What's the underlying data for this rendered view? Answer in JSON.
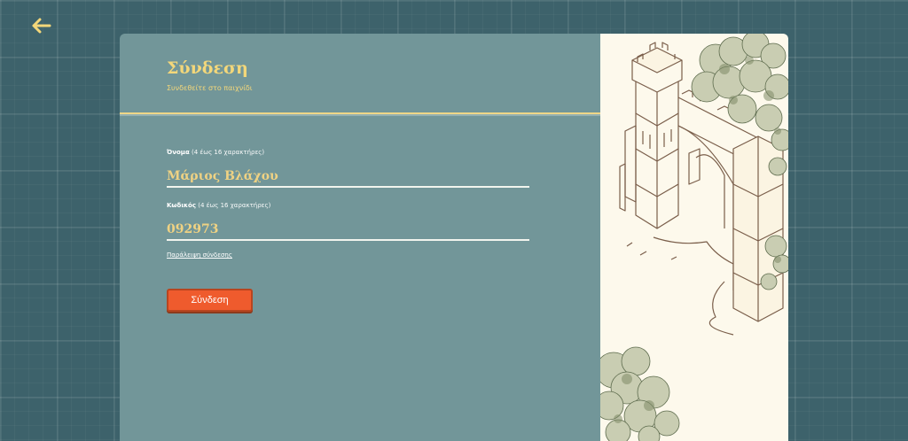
{
  "nav": {
    "back_icon": "arrow-left-icon",
    "back_color": "#f3d77a"
  },
  "login": {
    "title": "Σύνδεση",
    "subtitle": "Συνδεθείτε στο παιχνίδι",
    "name_label": "Όνομα",
    "name_hint": "(4 έως 16 χαρακτήρες)",
    "name_value": "Μάριος Βλάχου",
    "code_label": "Κωδικός",
    "code_hint": "(4 έως 16 χαρακτήρες)",
    "code_value": "092973",
    "skip_link": "Παράλειψη σύνδεσης",
    "submit_label": "Σύνδεση"
  },
  "colors": {
    "background": "#3d626b",
    "panel": "#729699",
    "accent_text": "#f3d77a",
    "button": "#ef5b2d",
    "art_background": "#fdf9ec"
  },
  "illustration": {
    "icon": "castle-gate-illustration"
  }
}
